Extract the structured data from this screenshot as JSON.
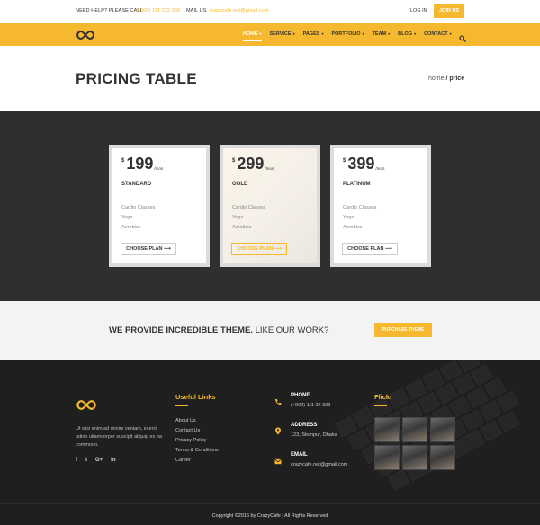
{
  "topbar": {
    "help_label": "NEED HELP? PLEASE CALL",
    "help_phone": "(+000) 111 222 333",
    "mail_label": "MAIL US",
    "mail_value": "crazycafe.net@gmail.com",
    "login": "LOG IN",
    "join": "JOIN US"
  },
  "nav": {
    "items": [
      {
        "label": "HOME",
        "caret": "▾"
      },
      {
        "label": "SERVICE",
        "caret": "▾"
      },
      {
        "label": "PAGES",
        "caret": "▾"
      },
      {
        "label": "PORTFOLIO",
        "caret": "▾"
      },
      {
        "label": "TEAM",
        "caret": "▾"
      },
      {
        "label": "BLOG",
        "caret": "▾"
      },
      {
        "label": "CONTACT",
        "caret": "▾"
      }
    ],
    "search_icon": "search-icon",
    "accent": "#f5b82e"
  },
  "page": {
    "title": "PRICING TABLE",
    "breadcrumb_home": "home",
    "breadcrumb_current": "/ price"
  },
  "pricing": {
    "currency": "$",
    "per": "/mon",
    "plans": [
      {
        "price": "199",
        "name": "STANDARD",
        "features": [
          "Cardio Classes",
          "Yoga",
          "Aerobics"
        ],
        "button": "CHOOSE PLAN  ⟶"
      },
      {
        "price": "299",
        "name": "GOLD",
        "features": [
          "Cardio Classes",
          "Yoga",
          "Aerobics"
        ],
        "button": "CHOOSE PLAN  ⟶"
      },
      {
        "price": "399",
        "name": "PLATINUM",
        "features": [
          "Cardio Classes",
          "Yoga",
          "Aerobics"
        ],
        "button": "CHOOSE PLAN  ⟶"
      }
    ]
  },
  "cta": {
    "bold": "WE PROVIDE INCREDIBLE THEME.",
    "rest": " LIKE OUR WORK?",
    "button": "PURCHASE THEME"
  },
  "footer": {
    "description": "Ut wisi enim ad minim veniam, exerci tation ullamcorper suscipit aliquip ex ea commodo.",
    "social": [
      "f",
      "t",
      "G+",
      "in"
    ],
    "links_title": "Useful Links",
    "links": [
      "About Us",
      "Contact Us",
      "Privacy Policy",
      "Terms & Conditions",
      "Career"
    ],
    "phone_label": "PHONE",
    "phone_value": "(+000) 111 22 333",
    "address_label": "ADDRESS",
    "address_value": "123, Stompur, Dhaka",
    "email_label": "EMAIL",
    "email_value": "crazycafe.net@gmail.com",
    "flickr_title": "Flickr",
    "copyright": "Copyright ©2016 by CrazyCafe   |   All Rights Reserved"
  }
}
